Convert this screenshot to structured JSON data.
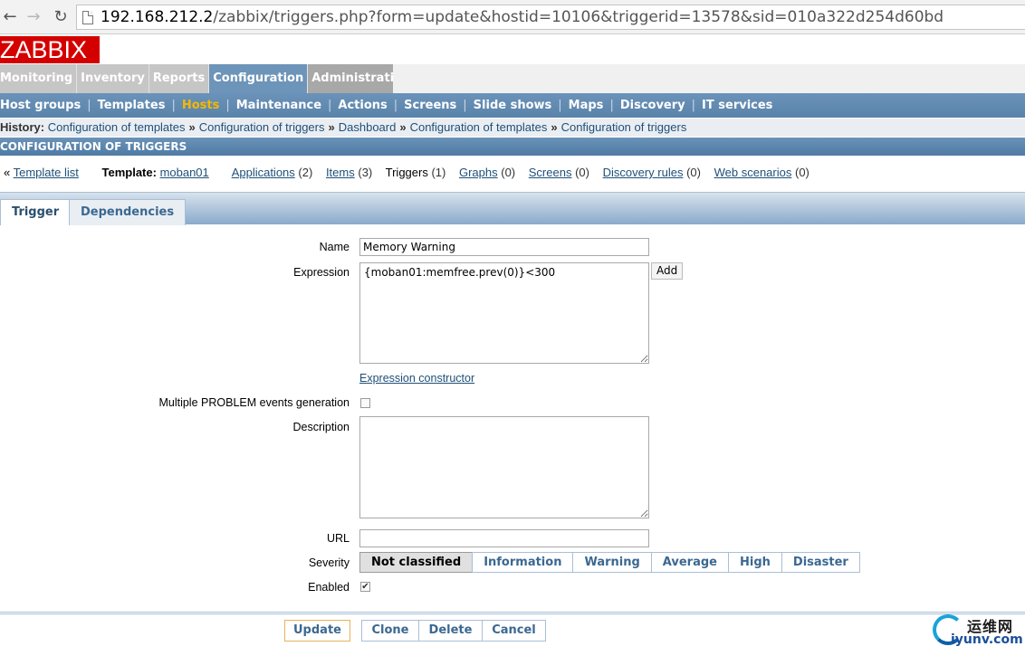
{
  "browser": {
    "url_host": "192.168.212.2",
    "url_rest": "/zabbix/triggers.php?form=update&hostid=10106&triggerid=13578&sid=010a322d254d60bd"
  },
  "logo": "ZABBIX",
  "main_menu": [
    "Monitoring",
    "Inventory",
    "Reports",
    "Configuration",
    "Administration"
  ],
  "sub_menu": [
    "Host groups",
    "Templates",
    "Hosts",
    "Maintenance",
    "Actions",
    "Screens",
    "Slide shows",
    "Maps",
    "Discovery",
    "IT services"
  ],
  "history": {
    "label": "History:",
    "items": [
      "Configuration of templates",
      "Configuration of triggers",
      "Dashboard",
      "Configuration of templates",
      "Configuration of triggers"
    ]
  },
  "header": "CONFIGURATION OF TRIGGERS",
  "objnav": {
    "template_list": "Template list",
    "template_label": "Template:",
    "template_name": "moban01",
    "applications": "Applications",
    "applications_count": "(2)",
    "items": "Items",
    "items_count": "(3)",
    "triggers": "Triggers",
    "triggers_count": "(1)",
    "graphs": "Graphs",
    "graphs_count": "(0)",
    "screens": "Screens",
    "screens_count": "(0)",
    "discovery": "Discovery rules",
    "discovery_count": "(0)",
    "web": "Web scenarios",
    "web_count": "(0)"
  },
  "tabs": [
    "Trigger",
    "Dependencies"
  ],
  "form": {
    "name_label": "Name",
    "name_value": "Memory Warning",
    "expression_label": "Expression",
    "expression_value": "{moban01:memfree.prev(0)}<300",
    "add_button": "Add",
    "expression_constructor": "Expression constructor",
    "multiple_label": "Multiple PROBLEM events generation",
    "description_label": "Description",
    "description_value": "",
    "url_label": "URL",
    "url_value": "",
    "severity_label": "Severity",
    "severities": [
      "Not classified",
      "Information",
      "Warning",
      "Average",
      "High",
      "Disaster"
    ],
    "severity_selected": "Not classified",
    "enabled_label": "Enabled",
    "enabled": true
  },
  "buttons": [
    "Update",
    "Clone",
    "Delete",
    "Cancel"
  ],
  "watermark": {
    "top": "运维网",
    "bottom": "iyunv.com"
  },
  "colors": {
    "brand": "#d40000",
    "accent": "#6d94b9",
    "active_hosts": "#f5b800"
  }
}
